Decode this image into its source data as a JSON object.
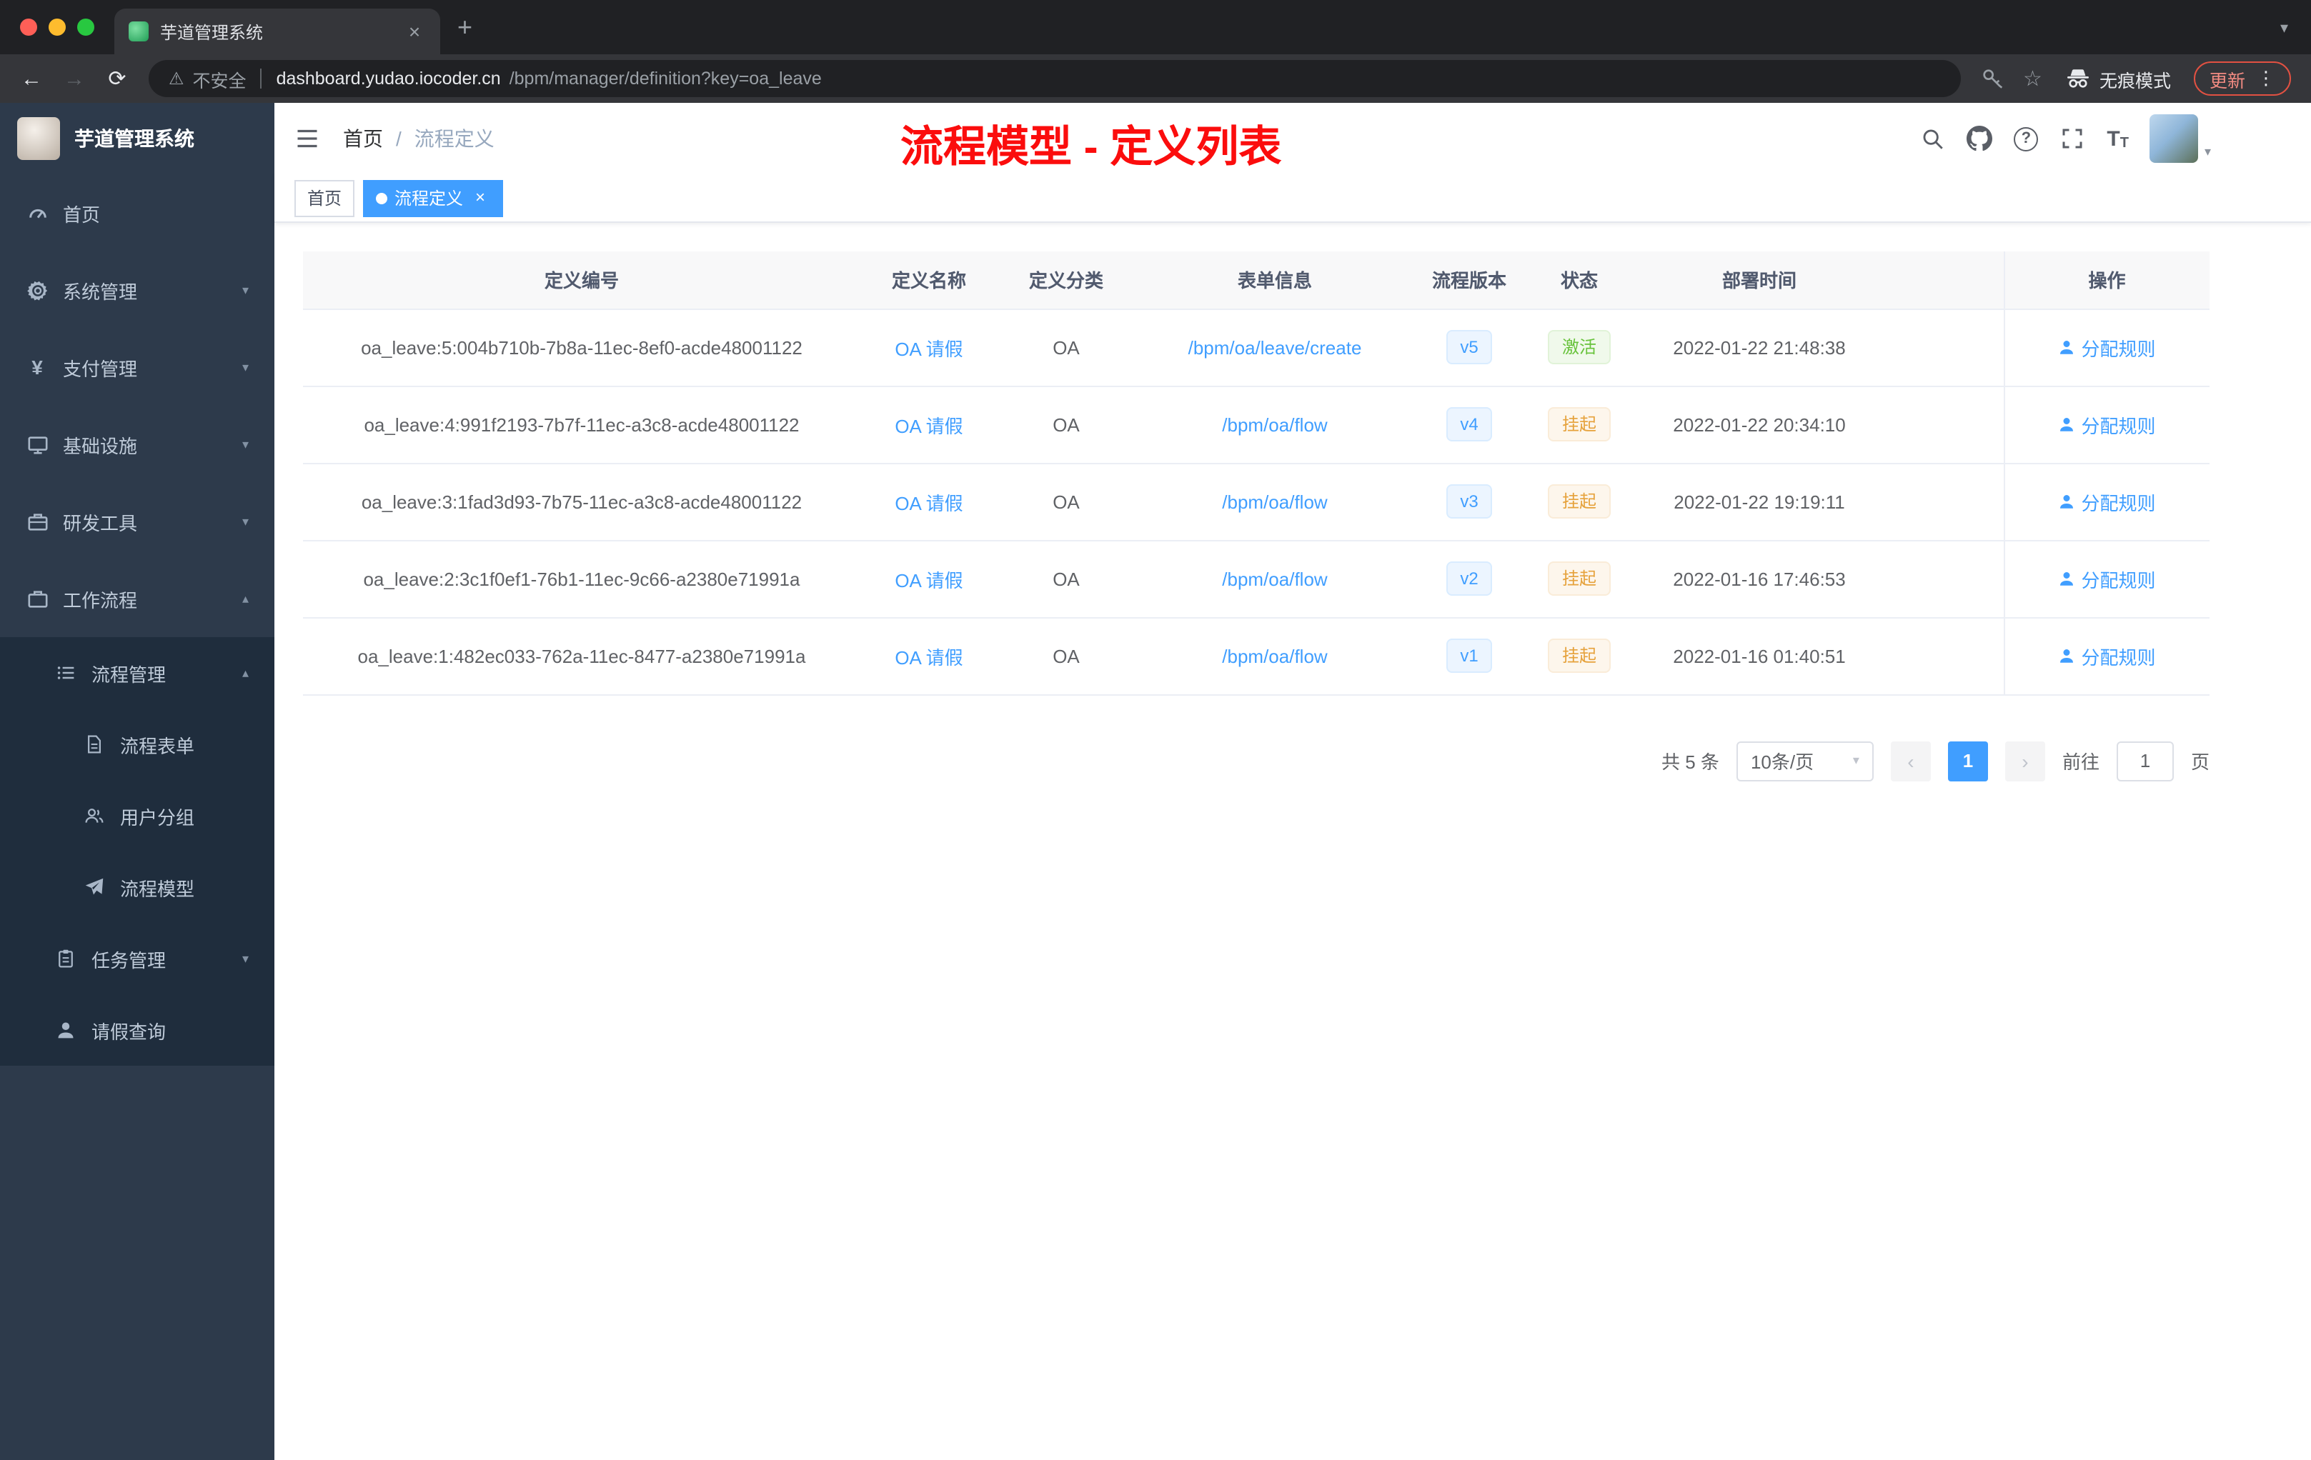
{
  "browser": {
    "tab_title": "芋道管理系统",
    "security_label": "不安全",
    "url_domain": "dashboard.yudao.iocoder.cn",
    "url_path": "/bpm/manager/definition?key=oa_leave",
    "incognito_label": "无痕模式",
    "update_label": "更新"
  },
  "icons": {
    "close": "×",
    "plus": "+",
    "window_chevron": "▾",
    "back": "←",
    "forward": "→",
    "reload": "⟳",
    "warning": "⚠",
    "star": "☆",
    "dots": "⋮",
    "chevron_down": "▾",
    "chevron_up": "▴",
    "question": "?",
    "font_large": "T",
    "font_small": "T",
    "prev": "‹",
    "next": "›",
    "select_caret": "▾",
    "avatar_caret": "▾",
    "crumb_sep": "/"
  },
  "sidebar": {
    "logo_title": "芋道管理系统",
    "items": [
      {
        "label": "首页"
      },
      {
        "label": "系统管理"
      },
      {
        "label": "支付管理"
      },
      {
        "label": "基础设施"
      },
      {
        "label": "研发工具"
      },
      {
        "label": "工作流程"
      },
      {
        "label": "流程管理"
      },
      {
        "label": "流程表单"
      },
      {
        "label": "用户分组"
      },
      {
        "label": "流程模型"
      },
      {
        "label": "任务管理"
      },
      {
        "label": "请假查询"
      }
    ]
  },
  "header": {
    "breadcrumb_home": "首页",
    "breadcrumb_current": "流程定义",
    "annotation": "流程模型 - 定义列表"
  },
  "tags": {
    "home": "首页",
    "active": "流程定义"
  },
  "table": {
    "columns": [
      "定义编号",
      "定义名称",
      "定义分类",
      "表单信息",
      "流程版本",
      "状态",
      "部署时间",
      "操作"
    ],
    "rows": [
      {
        "id": "oa_leave:5:004b710b-7b8a-11ec-8ef0-acde48001122",
        "name": "OA 请假",
        "category": "OA",
        "form": "/bpm/oa/leave/create",
        "version": "v5",
        "status": "激活",
        "time": "2022-01-22 21:48:38",
        "action": "分配规则"
      },
      {
        "id": "oa_leave:4:991f2193-7b7f-11ec-a3c8-acde48001122",
        "name": "OA 请假",
        "category": "OA",
        "form": "/bpm/oa/flow",
        "version": "v4",
        "status": "挂起",
        "time": "2022-01-22 20:34:10",
        "action": "分配规则"
      },
      {
        "id": "oa_leave:3:1fad3d93-7b75-11ec-a3c8-acde48001122",
        "name": "OA 请假",
        "category": "OA",
        "form": "/bpm/oa/flow",
        "version": "v3",
        "status": "挂起",
        "time": "2022-01-22 19:19:11",
        "action": "分配规则"
      },
      {
        "id": "oa_leave:2:3c1f0ef1-76b1-11ec-9c66-a2380e71991a",
        "name": "OA 请假",
        "category": "OA",
        "form": "/bpm/oa/flow",
        "version": "v2",
        "status": "挂起",
        "time": "2022-01-16 17:46:53",
        "action": "分配规则"
      },
      {
        "id": "oa_leave:1:482ec033-762a-11ec-8477-a2380e71991a",
        "name": "OA 请假",
        "category": "OA",
        "form": "/bpm/oa/flow",
        "version": "v1",
        "status": "挂起",
        "time": "2022-01-16 01:40:51",
        "action": "分配规则"
      }
    ]
  },
  "pagination": {
    "total": "共 5 条",
    "page_size": "10条/页",
    "current_page": "1",
    "goto_label": "前往",
    "goto_value": "1",
    "unit_label": "页"
  },
  "colors": {
    "accent": "#409eff",
    "success": "#67c23a",
    "warning": "#e6a23c",
    "annotation": "#ff0000"
  }
}
